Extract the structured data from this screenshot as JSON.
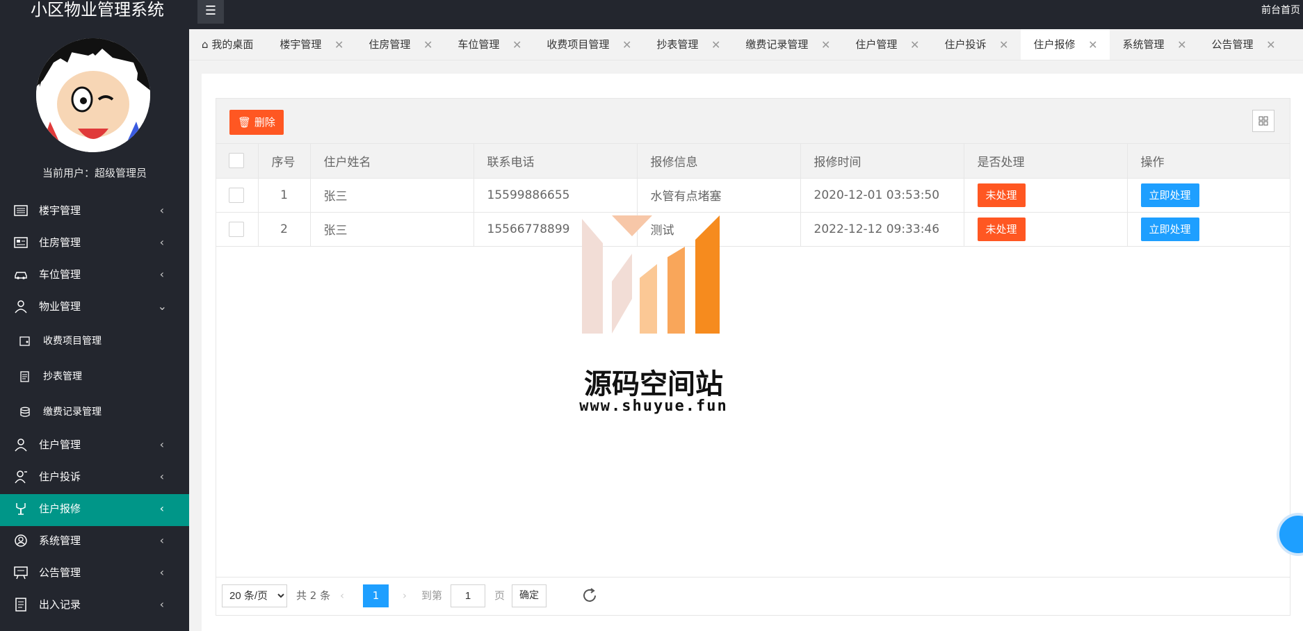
{
  "app": {
    "title": "小区物业管理系统",
    "header_link": "前台首页",
    "current_user": "当前用户：超级管理员"
  },
  "sidebar": {
    "items": [
      {
        "label": "楼宇管理",
        "icon": "building-icon",
        "expanded": false
      },
      {
        "label": "住房管理",
        "icon": "house-icon",
        "expanded": false
      },
      {
        "label": "车位管理",
        "icon": "car-icon",
        "expanded": false
      },
      {
        "label": "物业管理",
        "icon": "user-icon",
        "expanded": true,
        "children": [
          {
            "label": "收费项目管理",
            "icon": "wallet-icon"
          },
          {
            "label": "抄表管理",
            "icon": "meter-icon"
          },
          {
            "label": "缴费记录管理",
            "icon": "database-icon"
          }
        ]
      },
      {
        "label": "住户管理",
        "icon": "person-icon",
        "expanded": false
      },
      {
        "label": "住户投诉",
        "icon": "complaint-icon",
        "expanded": false
      },
      {
        "label": "住户报修",
        "icon": "repair-icon",
        "expanded": false,
        "active": true
      },
      {
        "label": "系统管理",
        "icon": "user-circle-icon",
        "expanded": false
      },
      {
        "label": "公告管理",
        "icon": "notice-icon",
        "expanded": false
      },
      {
        "label": "出入记录",
        "icon": "record-icon",
        "expanded": false
      }
    ]
  },
  "tabs": [
    {
      "label": "我的桌面",
      "closable": false
    },
    {
      "label": "楼宇管理",
      "closable": true
    },
    {
      "label": "住房管理",
      "closable": true
    },
    {
      "label": "车位管理",
      "closable": true
    },
    {
      "label": "收费项目管理",
      "closable": true
    },
    {
      "label": "抄表管理",
      "closable": true
    },
    {
      "label": "缴费记录管理",
      "closable": true
    },
    {
      "label": "住户管理",
      "closable": true
    },
    {
      "label": "住户投诉",
      "closable": true
    },
    {
      "label": "住户报修",
      "closable": true,
      "active": true
    },
    {
      "label": "系统管理",
      "closable": true
    },
    {
      "label": "公告管理",
      "closable": true
    }
  ],
  "toolbar": {
    "delete_label": "删除"
  },
  "table": {
    "columns": [
      "序号",
      "住户姓名",
      "联系电话",
      "报修信息",
      "报修时间",
      "是否处理",
      "操作"
    ],
    "rows": [
      {
        "index": "1",
        "name": "张三",
        "phone": "15599886655",
        "info": "水管有点堵塞",
        "time": "2020-12-01 03:53:50",
        "status": "未处理",
        "action": "立即处理"
      },
      {
        "index": "2",
        "name": "张三",
        "phone": "15566778899",
        "info": "测试",
        "time": "2022-12-12 09:33:46",
        "status": "未处理",
        "action": "立即处理"
      }
    ]
  },
  "pager": {
    "limit": "20 条/页",
    "total": "共 2 条",
    "current_page": "1",
    "goto_label": "到第",
    "goto_value": "1",
    "page_label": "页",
    "confirm_label": "确定"
  },
  "watermark": {
    "title": "源码空间站",
    "url": "www.shuyue.fun"
  },
  "colors": {
    "sidebar_bg": "#23262e",
    "active": "#009688",
    "danger": "#ff5722",
    "primary": "#1e9fff"
  }
}
